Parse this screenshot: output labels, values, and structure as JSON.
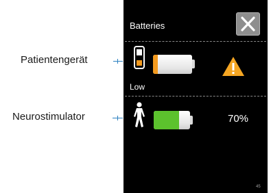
{
  "callouts": {
    "patient_device_label": "Patientengerät",
    "neurostimulator_label": "Neurostimulator"
  },
  "screen": {
    "title": "Batteries",
    "close_icon": "close-x-icon",
    "version": "45"
  },
  "patient_device": {
    "icon": "handheld-device-icon",
    "status": "Low",
    "battery_level": 0.12,
    "battery_color": "#f39a1e",
    "warning_icon": "warning-triangle-icon",
    "warning_color": "#f5a623"
  },
  "neurostimulator": {
    "icon": "person-icon",
    "percent": "70%",
    "battery_level": 0.7,
    "battery_color": "#5cc22d"
  }
}
